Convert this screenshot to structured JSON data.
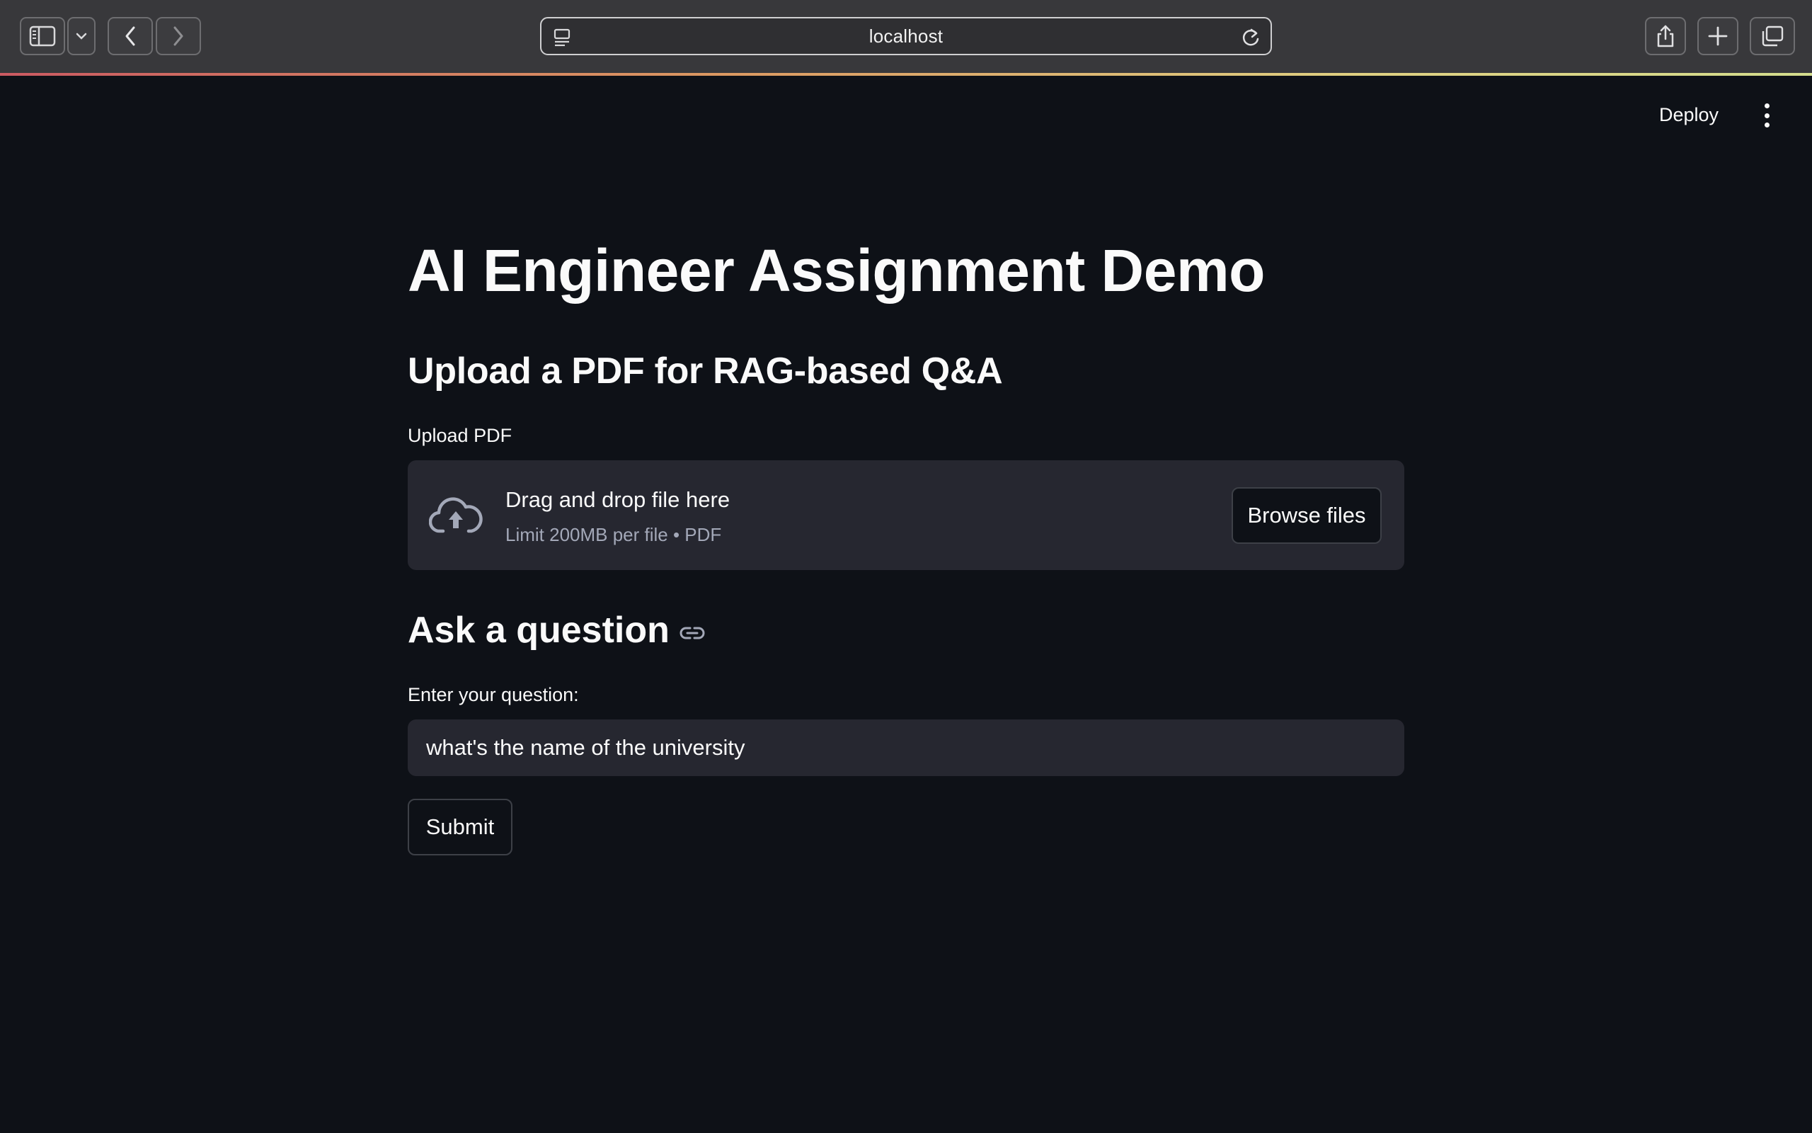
{
  "browser": {
    "url": "localhost",
    "icons": {
      "sidebar": "sidebar-toggle-icon",
      "sidebar_menu": "chevron-down-icon",
      "back": "chevron-left-icon",
      "forward": "chevron-right-icon",
      "site": "site-settings-icon",
      "reload": "reload-icon",
      "share": "share-icon",
      "new_tab": "plus-icon",
      "tabs": "tab-overview-icon"
    }
  },
  "header": {
    "deploy_label": "Deploy",
    "menu_icon": "vertical-dots-icon"
  },
  "main": {
    "title": "AI Engineer Assignment Demo",
    "upload_section": {
      "heading": "Upload a PDF for RAG-based Q&A",
      "label": "Upload PDF",
      "dropzone_text": "Drag and drop file here",
      "limit_text": "Limit 200MB per file • PDF",
      "browse_label": "Browse files",
      "icon": "cloud-upload-icon"
    },
    "question_section": {
      "heading": "Ask a question",
      "heading_icon": "link-icon",
      "input_label": "Enter your question:",
      "input_value": "what's the name of the university",
      "submit_label": "Submit"
    }
  },
  "colors": {
    "background": "#0e1117",
    "surface": "#262730",
    "text": "#fafafa",
    "muted_text": "#a3a8b8",
    "chrome": "#38383b"
  }
}
